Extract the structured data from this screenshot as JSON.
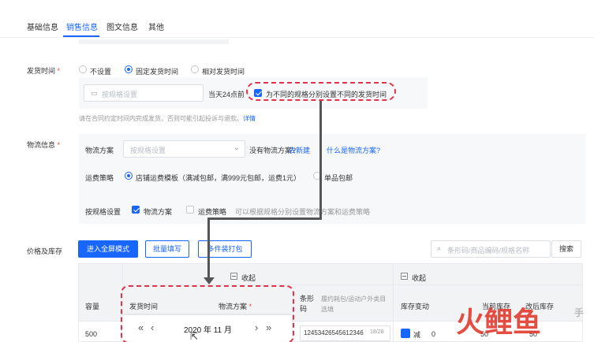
{
  "tabs": [
    {
      "label": "基础信息"
    },
    {
      "label": "销售信息"
    },
    {
      "label": "图文信息"
    },
    {
      "label": "其他"
    }
  ],
  "delivery": {
    "label": "发货时间",
    "required": "*",
    "options": [
      "不设置",
      "固定发货时间",
      "相对发货时间"
    ],
    "selected": "固定发货时间",
    "input_placeholder": "按规格设置",
    "suffix": "当天24点前",
    "checkbox_label": "为不同的规格分别设置不同的发货时间",
    "hint": "请在合同约定时间内完成发货，否则可能引起投诉与退款。",
    "hint_link": "详情"
  },
  "logistics": {
    "label": "物流信息",
    "required": "*",
    "plan_label": "物流方案",
    "plan_placeholder": "按规格设置",
    "no_plan_text": "没有物流方案?",
    "create_link": "去新建",
    "what_link": "什么是物流方案?",
    "fee_label": "运费策略",
    "fee_options": [
      "店铺运费模板（满减包邮，满999元包邮，运费1元）",
      "单品包邮"
    ],
    "by_spec_label": "按规格设置",
    "by_spec_options": [
      "物流方案",
      "运费策略"
    ],
    "by_spec_hint": "可以根据规格分别设置物流方案和运费策略"
  },
  "price_stock": {
    "label": "价格及库存",
    "btn_fullscreen": "进入全屏模式",
    "btn_batch": "批量填写",
    "btn_multi": "多件装打包",
    "search_placeholder": "条形码/商品编码/规格名称",
    "search_btn": "搜索"
  },
  "table": {
    "collapse1": "收起",
    "collapse2": "收起",
    "headers": [
      "容量",
      "发货时间",
      "物流方案",
      "条形码",
      "履约耗包/运动户外类目选填",
      "库存变动",
      "当前库存",
      "改后库存"
    ],
    "row": {
      "capacity": "500",
      "barcode": "12453426545612346",
      "barcode_count": "18/28",
      "stock_change_btn": "减",
      "stock_change_value": "0",
      "current_stock": "50",
      "new_stock": "50"
    },
    "required": "*"
  },
  "calendar": {
    "prev_year": "«",
    "prev_month": "‹",
    "title": "2020 年 11 月",
    "next_month": "›",
    "next_year": "»"
  },
  "watermark": {
    "text1": "火鲤鱼",
    "text2": "手"
  },
  "colors": {
    "accent": "#1966ff",
    "annotation": "#e0334c",
    "required": "#f24724"
  }
}
